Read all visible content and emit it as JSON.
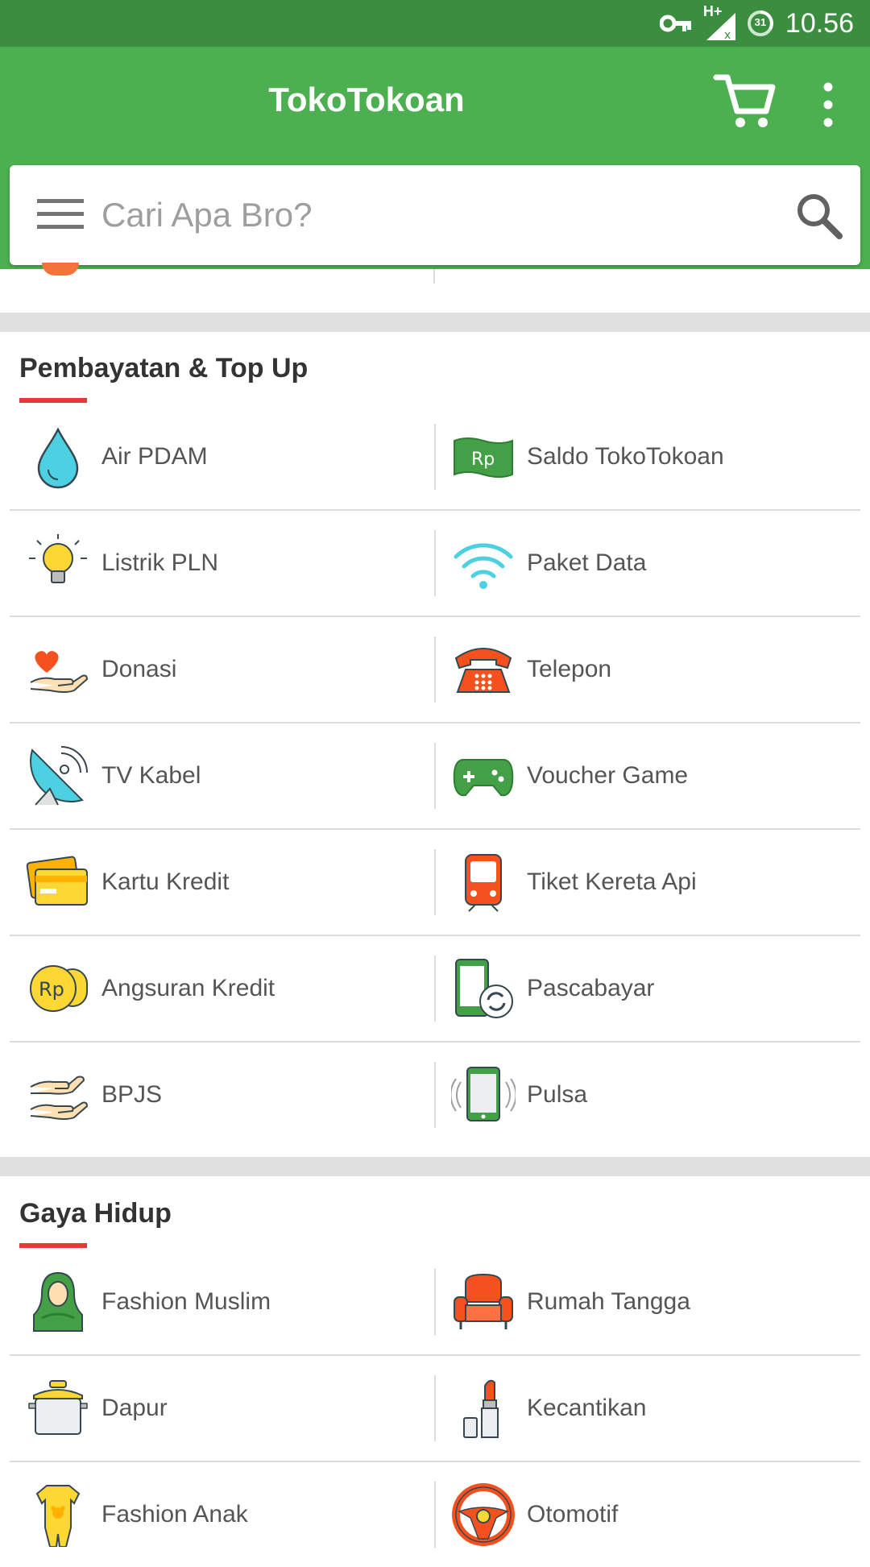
{
  "status_bar": {
    "time": "10.56",
    "battery_level": "31",
    "network_label": "H+"
  },
  "app_bar": {
    "title": "TokoTokoan",
    "cart_icon": "cart-icon",
    "more_icon": "more-vertical-icon"
  },
  "search": {
    "placeholder": "Cari Apa Bro?",
    "menu_icon": "menu-icon",
    "search_icon": "search-icon"
  },
  "colors": {
    "status_bar": "#3b8e3f",
    "app_bar": "#4caf50",
    "section_accent": "#e53935",
    "divider": "#dcdcdc"
  },
  "sections": [
    {
      "title": "Pembayatan & Top Up",
      "rows": [
        [
          {
            "label": "Air PDAM",
            "icon": "water-drop-icon"
          },
          {
            "label": "Saldo TokoTokoan",
            "icon": "money-note-icon"
          }
        ],
        [
          {
            "label": "Listrik PLN",
            "icon": "light-bulb-icon"
          },
          {
            "label": "Paket Data",
            "icon": "wifi-icon"
          }
        ],
        [
          {
            "label": "Donasi",
            "icon": "heart-hand-icon"
          },
          {
            "label": "Telepon",
            "icon": "telephone-icon"
          }
        ],
        [
          {
            "label": "TV Kabel",
            "icon": "satellite-dish-icon"
          },
          {
            "label": "Voucher Game",
            "icon": "gamepad-icon"
          }
        ],
        [
          {
            "label": "Kartu Kredit",
            "icon": "credit-card-icon"
          },
          {
            "label": "Tiket Kereta Api",
            "icon": "train-icon"
          }
        ],
        [
          {
            "label": "Angsuran Kredit",
            "icon": "coin-stack-icon"
          },
          {
            "label": "Pascabayar",
            "icon": "phone-sync-icon"
          }
        ],
        [
          {
            "label": "BPJS",
            "icon": "hands-icon"
          },
          {
            "label": "Pulsa",
            "icon": "phone-signal-icon"
          }
        ]
      ]
    },
    {
      "title": "Gaya Hidup",
      "rows": [
        [
          {
            "label": "Fashion Muslim",
            "icon": "hijab-icon"
          },
          {
            "label": "Rumah Tangga",
            "icon": "armchair-icon"
          }
        ],
        [
          {
            "label": "Dapur",
            "icon": "cooking-pot-icon"
          },
          {
            "label": "Kecantikan",
            "icon": "lipstick-icon"
          }
        ],
        [
          {
            "label": "Fashion Anak",
            "icon": "baby-romper-icon"
          },
          {
            "label": "Otomotif",
            "icon": "steering-wheel-icon"
          }
        ]
      ]
    }
  ]
}
